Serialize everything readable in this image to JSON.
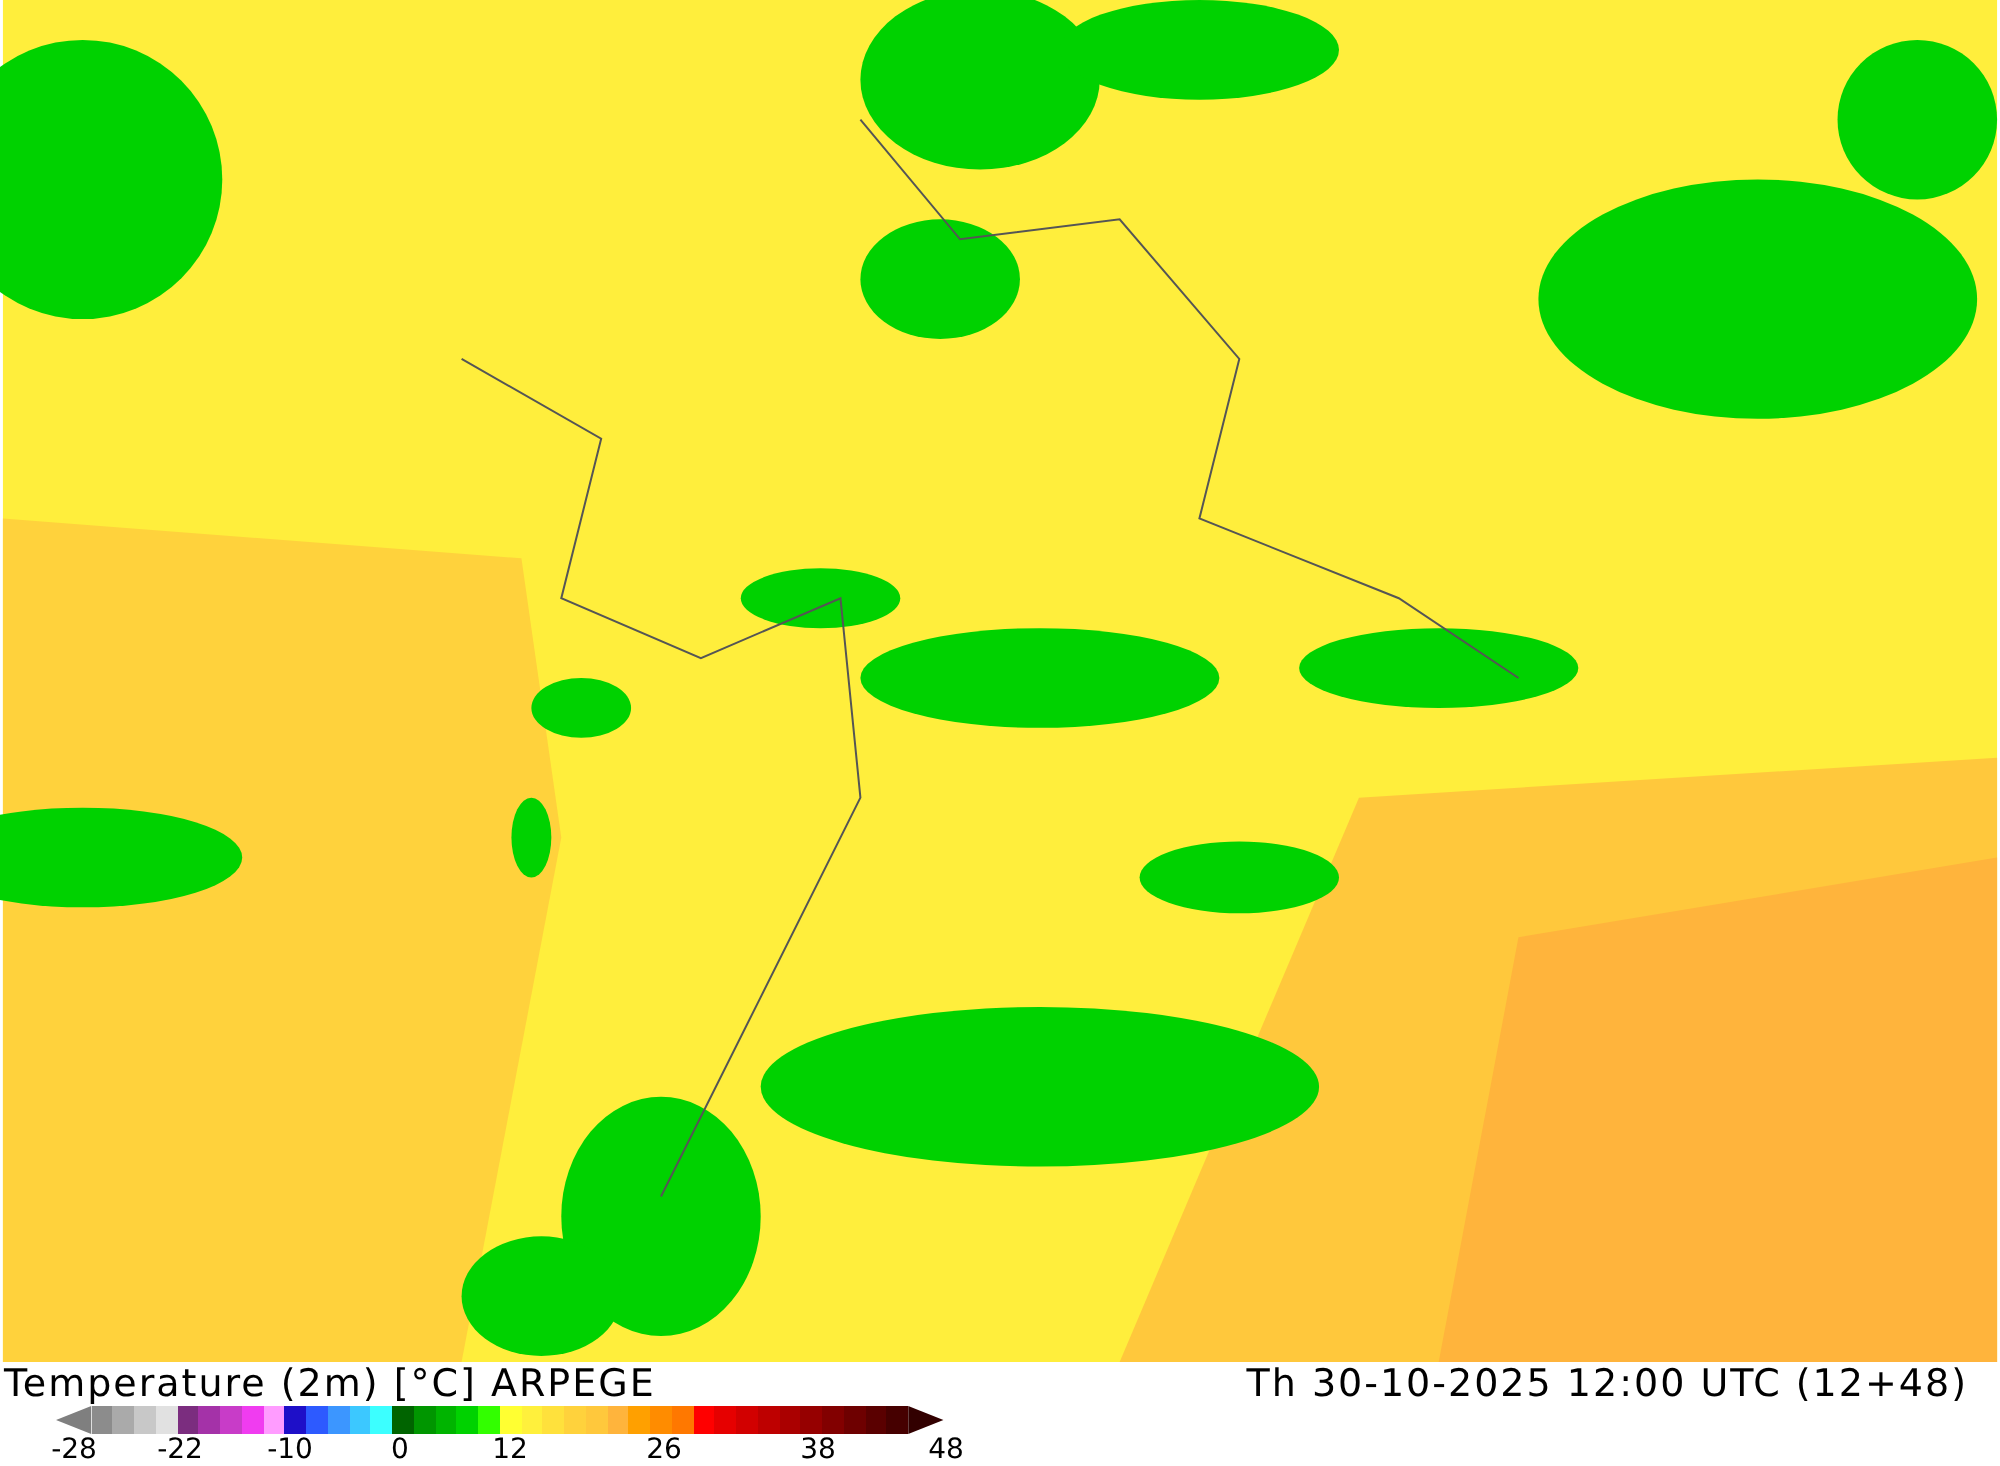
{
  "legend": {
    "title": "Temperature (2m) [°C] ARPEGE",
    "valid_time": "Th 30-10-2025 12:00 UTC (12+48)",
    "swatches": [
      {
        "color": "#8c8c8c"
      },
      {
        "color": "#aaaaaa"
      },
      {
        "color": "#c8c8c8"
      },
      {
        "color": "#e1e1e1"
      },
      {
        "color": "#7b2d7f"
      },
      {
        "color": "#a432a8"
      },
      {
        "color": "#c83cc8"
      },
      {
        "color": "#f03cf0"
      },
      {
        "color": "#ff9cff"
      },
      {
        "color": "#1e0fc8"
      },
      {
        "color": "#2d5aff"
      },
      {
        "color": "#3c96ff"
      },
      {
        "color": "#3cc8ff"
      },
      {
        "color": "#3cffff"
      },
      {
        "color": "#006400"
      },
      {
        "color": "#009600"
      },
      {
        "color": "#00b400"
      },
      {
        "color": "#00d200"
      },
      {
        "color": "#32ff00"
      },
      {
        "color": "#ffff32"
      },
      {
        "color": "#fff03c"
      },
      {
        "color": "#ffe13c"
      },
      {
        "color": "#ffd23c"
      },
      {
        "color": "#ffc83c"
      },
      {
        "color": "#ffb43c"
      },
      {
        "color": "#ffa000"
      },
      {
        "color": "#ff8c00"
      },
      {
        "color": "#ff7800"
      },
      {
        "color": "#ff0000"
      },
      {
        "color": "#e60000"
      },
      {
        "color": "#d20000"
      },
      {
        "color": "#be0000"
      },
      {
        "color": "#aa0000"
      },
      {
        "color": "#960000"
      },
      {
        "color": "#820000"
      },
      {
        "color": "#6e0000"
      },
      {
        "color": "#5a0000"
      },
      {
        "color": "#460000"
      }
    ],
    "ticks": [
      "-28",
      "-22",
      "-10",
      "0",
      "12",
      "26",
      "38",
      "48"
    ]
  }
}
